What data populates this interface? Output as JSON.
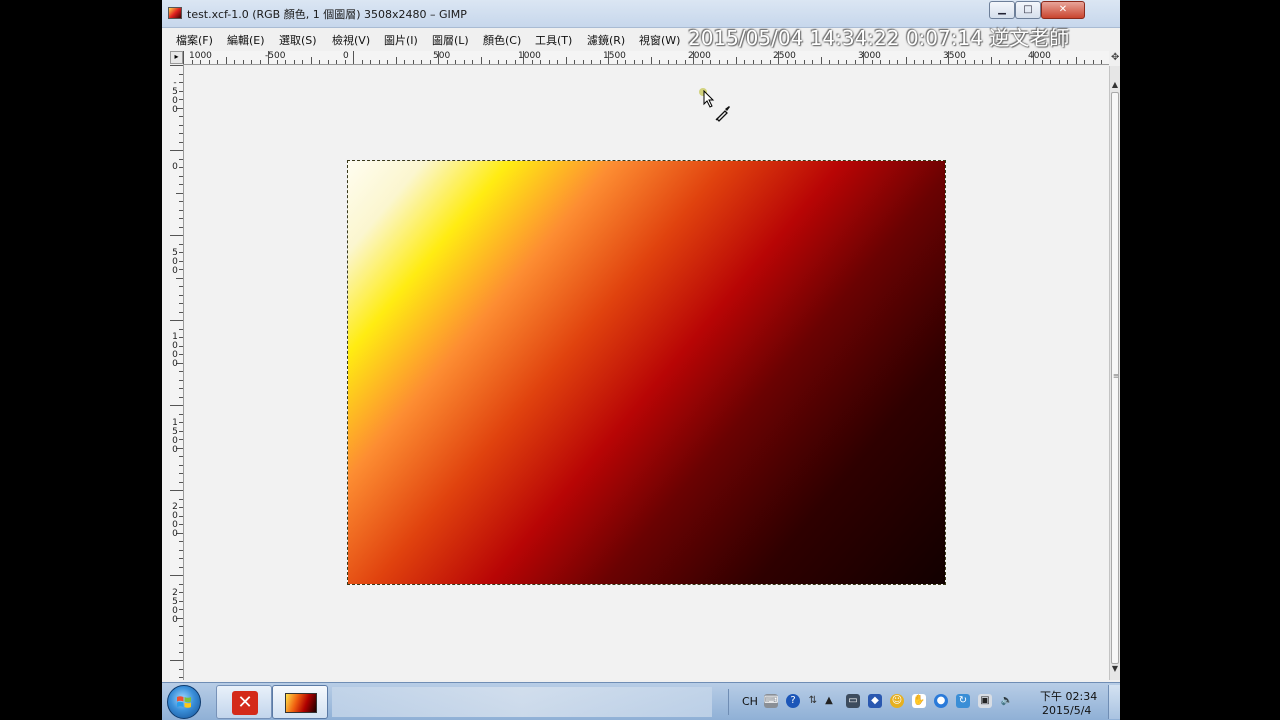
{
  "window": {
    "title": "test.xcf-1.0 (RGB 顏色, 1 個圖層) 3508x2480 – GIMP",
    "minimize_glyph": "▁",
    "maximize_glyph": "□",
    "close_glyph": "✕"
  },
  "menu": {
    "items": [
      "檔案(F)",
      "編輯(E)",
      "選取(S)",
      "檢視(V)",
      "圖片(I)",
      "圖層(L)",
      "顏色(C)",
      "工具(T)",
      "濾鏡(R)",
      "視窗(W)"
    ]
  },
  "overlay": {
    "stamp": "2015/05/04 14:34:22 0:07:14 逆文老師"
  },
  "ruler": {
    "corner_glyph": "▸",
    "h_labels": [
      "1000",
      "-500",
      "0",
      "500",
      "1000",
      "1500",
      "2000",
      "2500",
      "3000",
      "3500",
      "4000"
    ],
    "v_labels": [
      "-500",
      "0",
      "500",
      "1000",
      "1500",
      "2000",
      "2500"
    ]
  },
  "scrollbar": {
    "up_glyph": "▲",
    "down_glyph": "▼",
    "grip_glyph": "≡"
  },
  "image": {
    "colors": [
      "#fffdf0",
      "#ffec12",
      "#fd8d32",
      "#b80505",
      "#2f0000",
      "#120000"
    ]
  },
  "taskbar": {
    "xmind_glyph": "✕",
    "lang": "CH",
    "tray_icons": [
      "keyboard-icon",
      "help-icon",
      "network-icon",
      "arrow-up-icon",
      "monitor-icon",
      "shield-icon",
      "smiley-icon",
      "hand-icon",
      "globe-icon",
      "update-icon",
      "display-icon",
      "volume-icon"
    ],
    "clock_time": "下午 02:34",
    "clock_date": "2015/5/4"
  },
  "colors": {
    "accent": "#3a8fd9",
    "titlebar": "#c7d7ec",
    "taskbar": "#8fb0d6"
  }
}
